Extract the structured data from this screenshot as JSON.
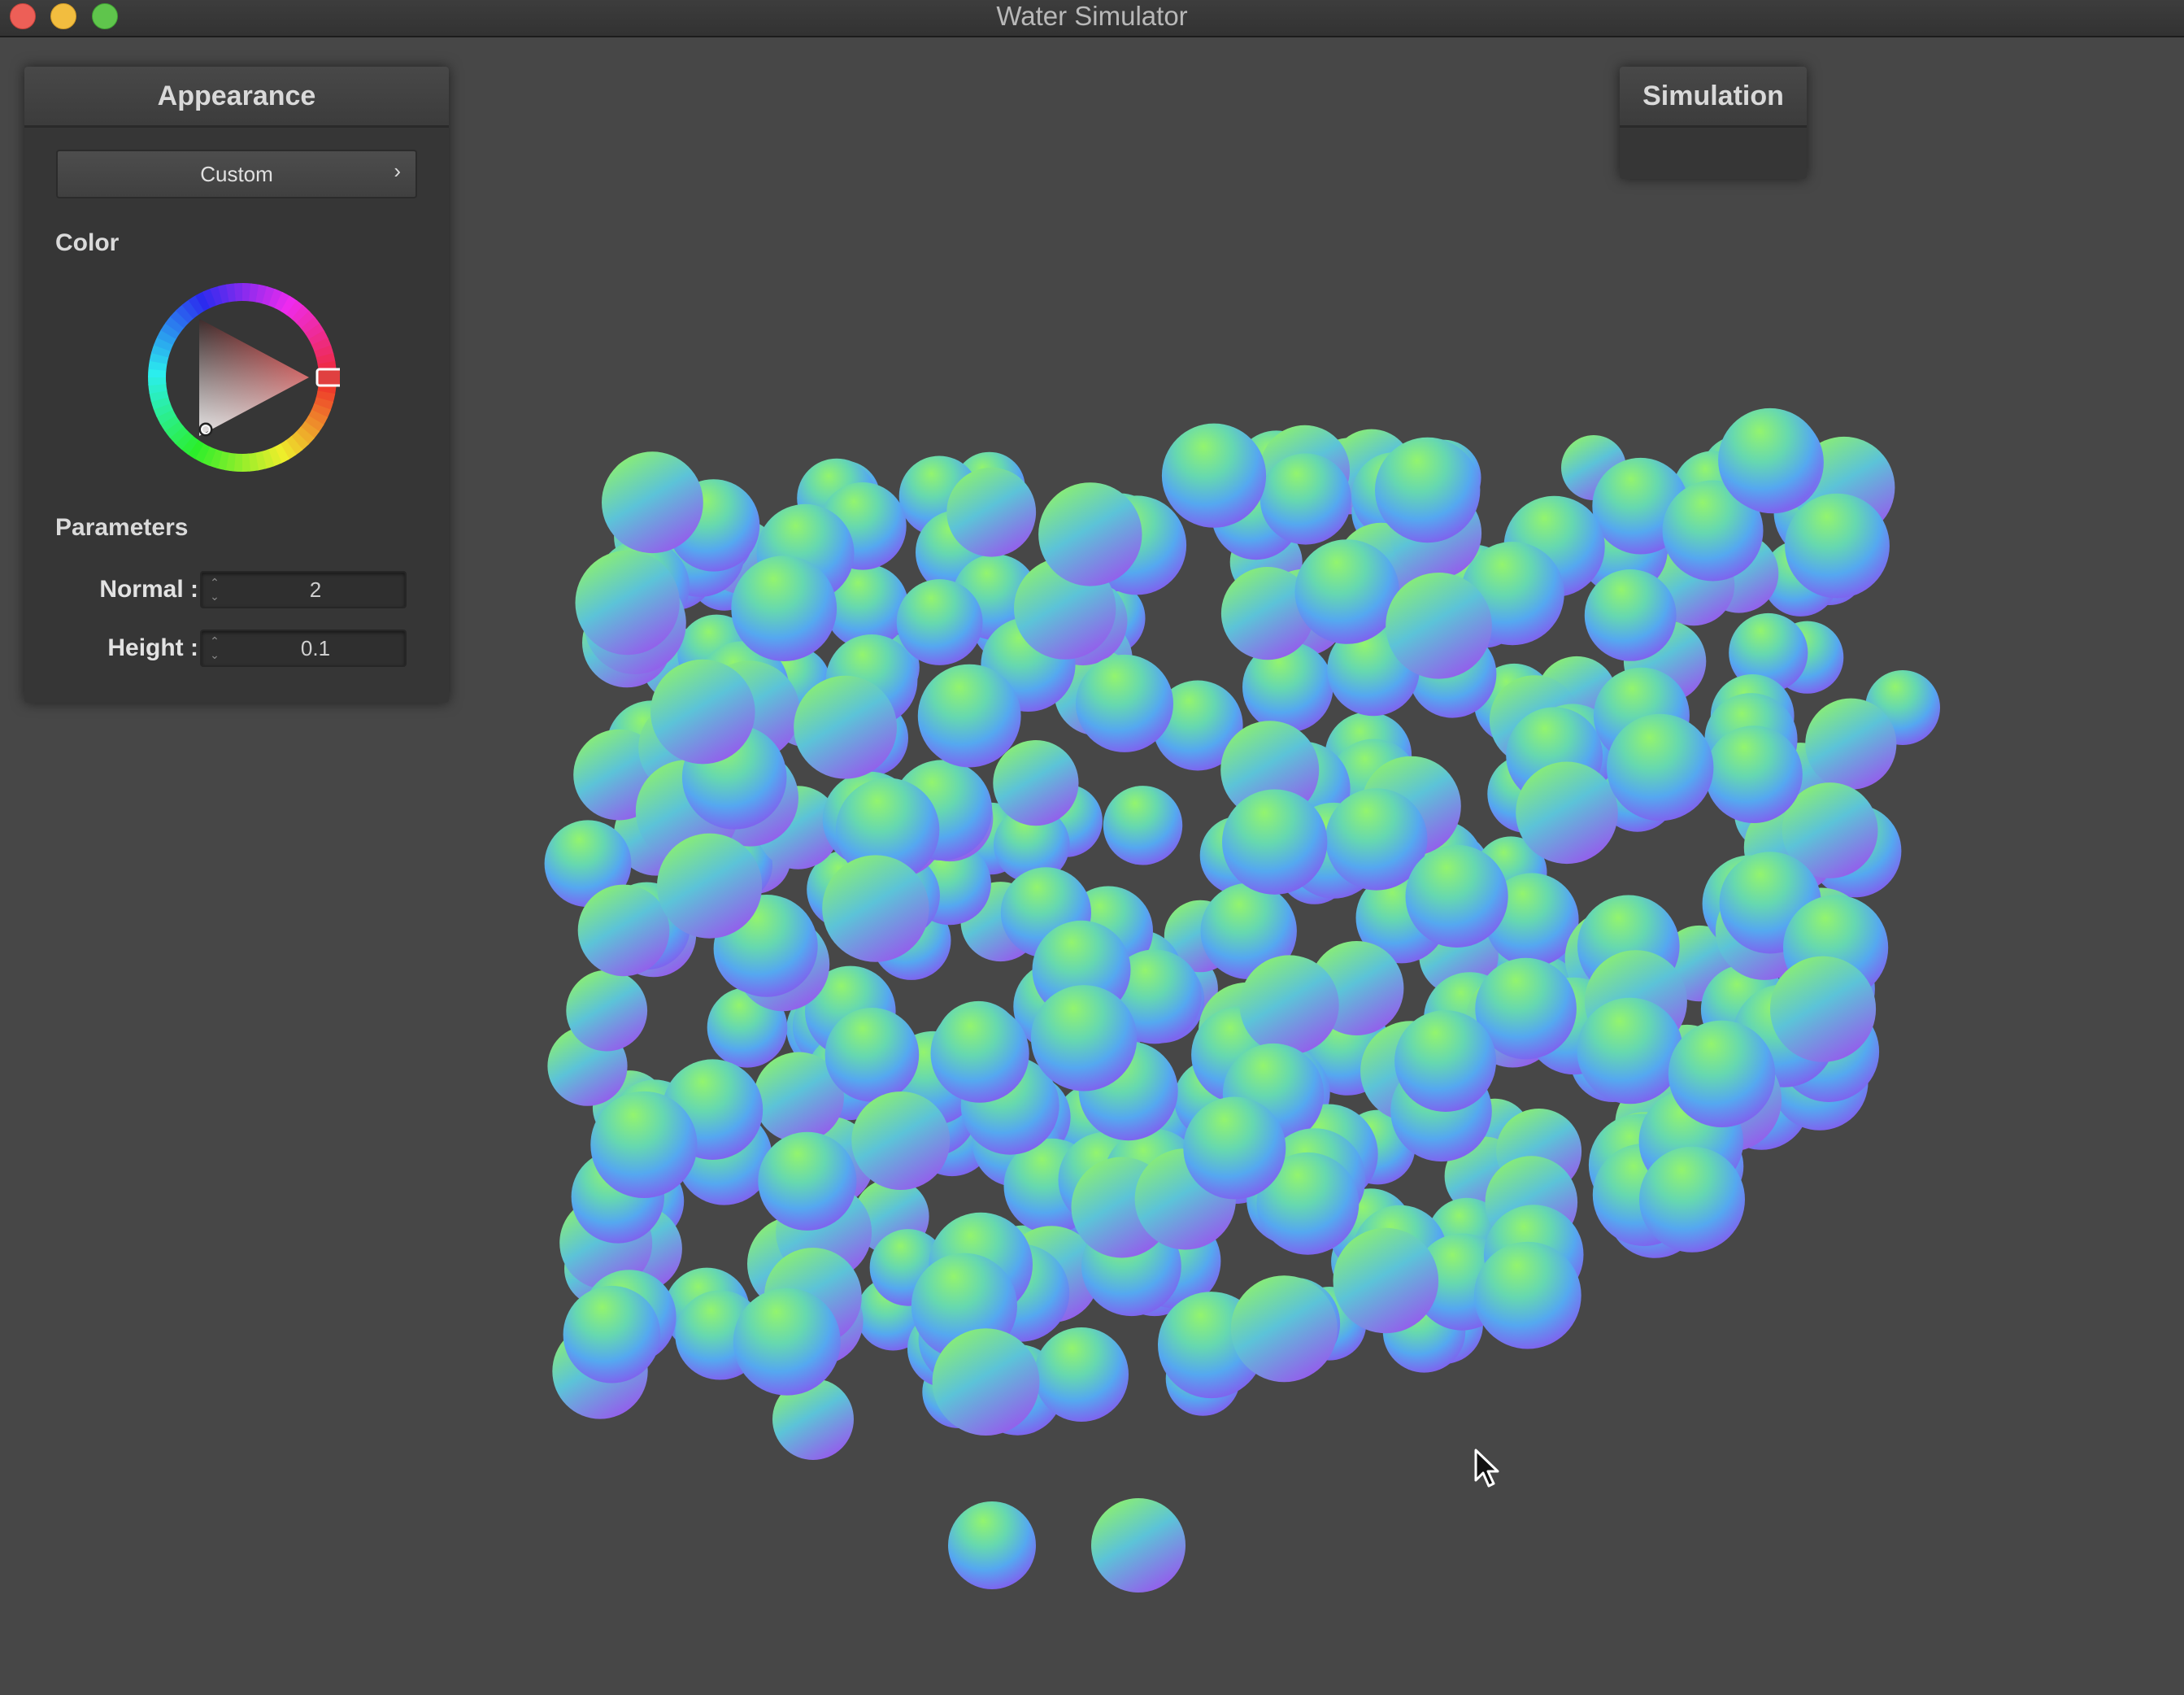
{
  "window": {
    "title": "Water Simulator",
    "buttons": [
      "close",
      "minimize",
      "zoom"
    ]
  },
  "appearance_panel": {
    "title": "Appearance",
    "preset": {
      "label": "Custom",
      "icon": "chevron-right-icon"
    },
    "color_label": "Color",
    "color": {
      "hex": "#c02a2a",
      "picker": "hsv-color-wheel"
    },
    "parameters_label": "Parameters",
    "parameters": [
      {
        "label": "Normal :",
        "value": "2"
      },
      {
        "label": "Height :",
        "value": "0.1"
      }
    ]
  },
  "simulation_panel": {
    "title": "Simulation"
  },
  "scene": {
    "type": "particle-spheres",
    "sphere_shading": "normal-map",
    "palette": [
      "#8cf06a",
      "#4fb8ef",
      "#9a56f0"
    ]
  }
}
